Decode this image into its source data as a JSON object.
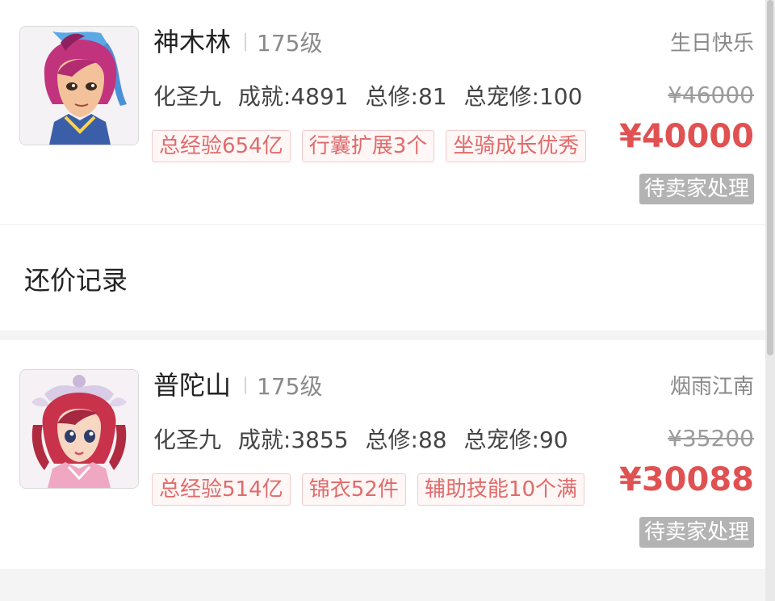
{
  "listings": [
    {
      "name": "神木林",
      "level": "175级",
      "server": "生日快乐",
      "stats": [
        "化圣九",
        "成就:4891",
        "总修:81",
        "总宠修:100"
      ],
      "tags": [
        "总经验654亿",
        "行囊扩展3个",
        "坐骑成长优秀"
      ],
      "original_price": "¥46000",
      "price": "¥40000",
      "status": "待卖家处理",
      "avatar_icon": "male-character-avatar"
    },
    {
      "name": "普陀山",
      "level": "175级",
      "server": "烟雨江南",
      "stats": [
        "化圣九",
        "成就:3855",
        "总修:88",
        "总宠修:90"
      ],
      "tags": [
        "总经验514亿",
        "锦衣52件",
        "辅助技能10个满"
      ],
      "original_price": "¥35200",
      "price": "¥30088",
      "status": "待卖家处理",
      "avatar_icon": "female-character-avatar"
    }
  ],
  "section": {
    "title": "还价记录"
  },
  "colors": {
    "price": "#e05151",
    "tag_text": "#e06b6b",
    "status_bg": "#b3b3b3"
  }
}
